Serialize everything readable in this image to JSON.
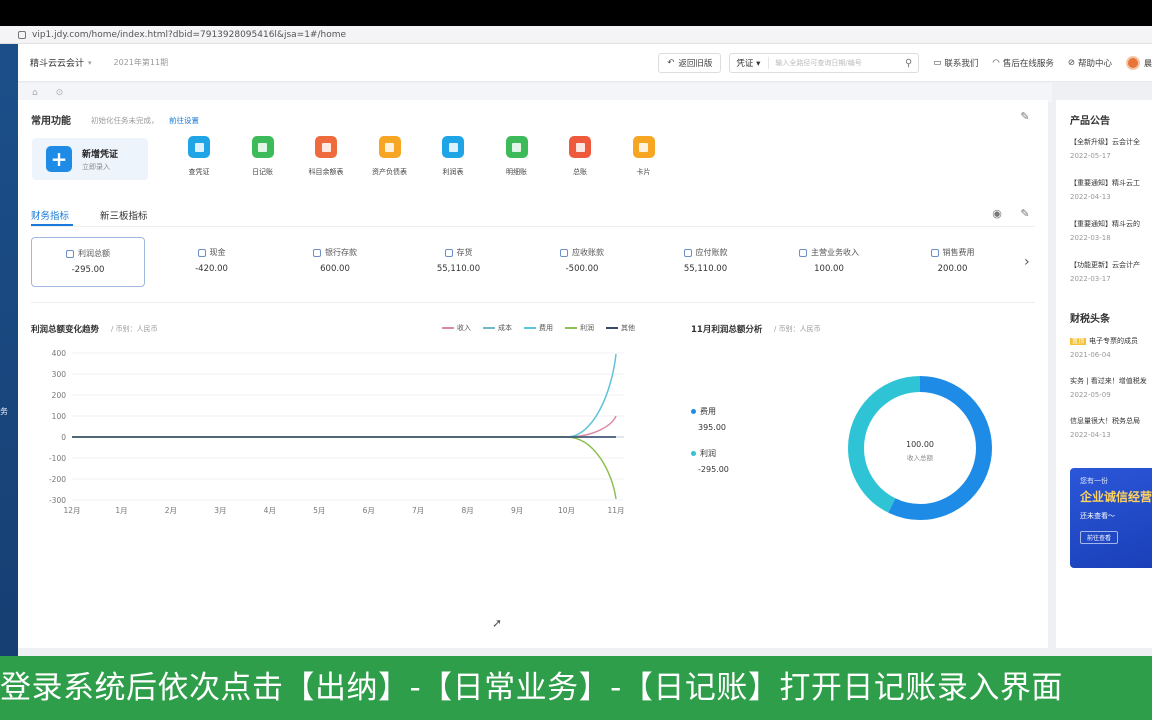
{
  "browser": {
    "url": "vip1.jdy.com/home/index.html?dbid=7913928095416l&jsa=1#/home"
  },
  "header": {
    "app_name": "精斗云云会计",
    "period": "2021年第11期",
    "back_button": "返回旧版",
    "search_select": "凭证",
    "search_placeholder": "输入全路径可查询日期/编号",
    "contact": "联系我们",
    "service": "售后在线服务",
    "help": "帮助中心"
  },
  "common": {
    "title": "常用功能",
    "hint": "初始化任务未完成，",
    "link": "前往设置",
    "new_voucher": {
      "label": "新增凭证",
      "sub": "立即录入"
    },
    "functions": [
      {
        "label": "查凭证",
        "color": "#1fa5e6"
      },
      {
        "label": "日记账",
        "color": "#3dbb5b"
      },
      {
        "label": "科目余额表",
        "color": "#ef6a3d"
      },
      {
        "label": "资产负债表",
        "color": "#f6a623"
      },
      {
        "label": "利润表",
        "color": "#1fa5e6"
      },
      {
        "label": "明细账",
        "color": "#3dbb5b"
      },
      {
        "label": "总账",
        "color": "#ef5a3d"
      },
      {
        "label": "卡片",
        "color": "#f6a623"
      }
    ]
  },
  "indicator_tabs": {
    "tab1": "财务指标",
    "tab2": "新三板指标"
  },
  "metrics": [
    {
      "label": "利润总额",
      "value": "-295.00"
    },
    {
      "label": "现金",
      "value": "-420.00"
    },
    {
      "label": "银行存款",
      "value": "600.00"
    },
    {
      "label": "存货",
      "value": "55,110.00"
    },
    {
      "label": "应收账款",
      "value": "-500.00"
    },
    {
      "label": "应付账款",
      "value": "55,110.00"
    },
    {
      "label": "主营业务收入",
      "value": "100.00"
    },
    {
      "label": "销售费用",
      "value": "200.00"
    }
  ],
  "trend": {
    "title": "利润总额变化趋势",
    "unit": "/ 币别：人民币",
    "legend": [
      "收入",
      "成本",
      "费用",
      "利润",
      "其他"
    ]
  },
  "chart_data": [
    {
      "type": "line",
      "title": "利润总额变化趋势",
      "categories": [
        "12月",
        "1月",
        "2月",
        "3月",
        "4月",
        "5月",
        "6月",
        "7月",
        "8月",
        "9月",
        "10月",
        "11月"
      ],
      "ylim": [
        -300,
        400
      ],
      "yticks": [
        400,
        300,
        200,
        100,
        0,
        -100,
        -200,
        -300
      ],
      "series": [
        {
          "name": "收入",
          "color": "#d98aa6",
          "values": [
            0,
            0,
            0,
            0,
            0,
            0,
            0,
            0,
            0,
            0,
            0,
            100
          ]
        },
        {
          "name": "成本",
          "color": "#6fb8c4",
          "values": [
            0,
            0,
            0,
            0,
            0,
            0,
            0,
            0,
            0,
            0,
            0,
            0
          ]
        },
        {
          "name": "费用",
          "color": "#5fc3d9",
          "values": [
            0,
            0,
            0,
            0,
            0,
            0,
            0,
            0,
            0,
            0,
            0,
            395
          ]
        },
        {
          "name": "利润",
          "color": "#8cc152",
          "values": [
            0,
            0,
            0,
            0,
            0,
            0,
            0,
            0,
            0,
            0,
            0,
            -295
          ]
        },
        {
          "name": "其他",
          "color": "#3b4a6b",
          "values": [
            0,
            0,
            0,
            0,
            0,
            0,
            0,
            0,
            0,
            0,
            0,
            0
          ]
        }
      ]
    },
    {
      "type": "pie",
      "title": "11月利润总额分析",
      "series": [
        {
          "name": "费用",
          "value": 395.0,
          "color": "#1e8ce6"
        },
        {
          "name": "利润",
          "value": -295.0,
          "color": "#2ec4d6"
        }
      ],
      "center_value": "100.00",
      "center_label": "收入总额"
    }
  ],
  "analysis": {
    "title": "11月利润总额分析",
    "unit": "/ 币别：人民币",
    "items": [
      {
        "name": "费用",
        "value": "395.00"
      },
      {
        "name": "利润",
        "value": "-295.00"
      }
    ],
    "center_value": "100.00",
    "center_label": "收入总额"
  },
  "announcements": {
    "title": "产品公告",
    "items": [
      {
        "text": "【全新升级】云会计全",
        "date": "2022-05-17"
      },
      {
        "text": "【重要通知】精斗云工",
        "date": "2022-04-13"
      },
      {
        "text": "【重要通知】精斗云的",
        "date": "2022-03-18"
      },
      {
        "text": "【功能更新】云会计产",
        "date": "2022-03-17"
      }
    ]
  },
  "tax_news": {
    "title": "财税头条",
    "tag": "置顶",
    "items": [
      {
        "text": "电子专票的成员",
        "date": "2021-06-04"
      },
      {
        "text": "实务 | 看过来！增值税发",
        "date": "2022-05-09"
      },
      {
        "text": "信息量很大！税务总局",
        "date": "2022-04-13"
      }
    ]
  },
  "banner": {
    "line1": "您有一份",
    "line2": "企业诚信经营",
    "line3": "还未查看～",
    "button": "前往查看"
  },
  "subtitle": "登录系统后依次点击【出纳】-【日常业务】-【日记账】打开日记账录入界面"
}
